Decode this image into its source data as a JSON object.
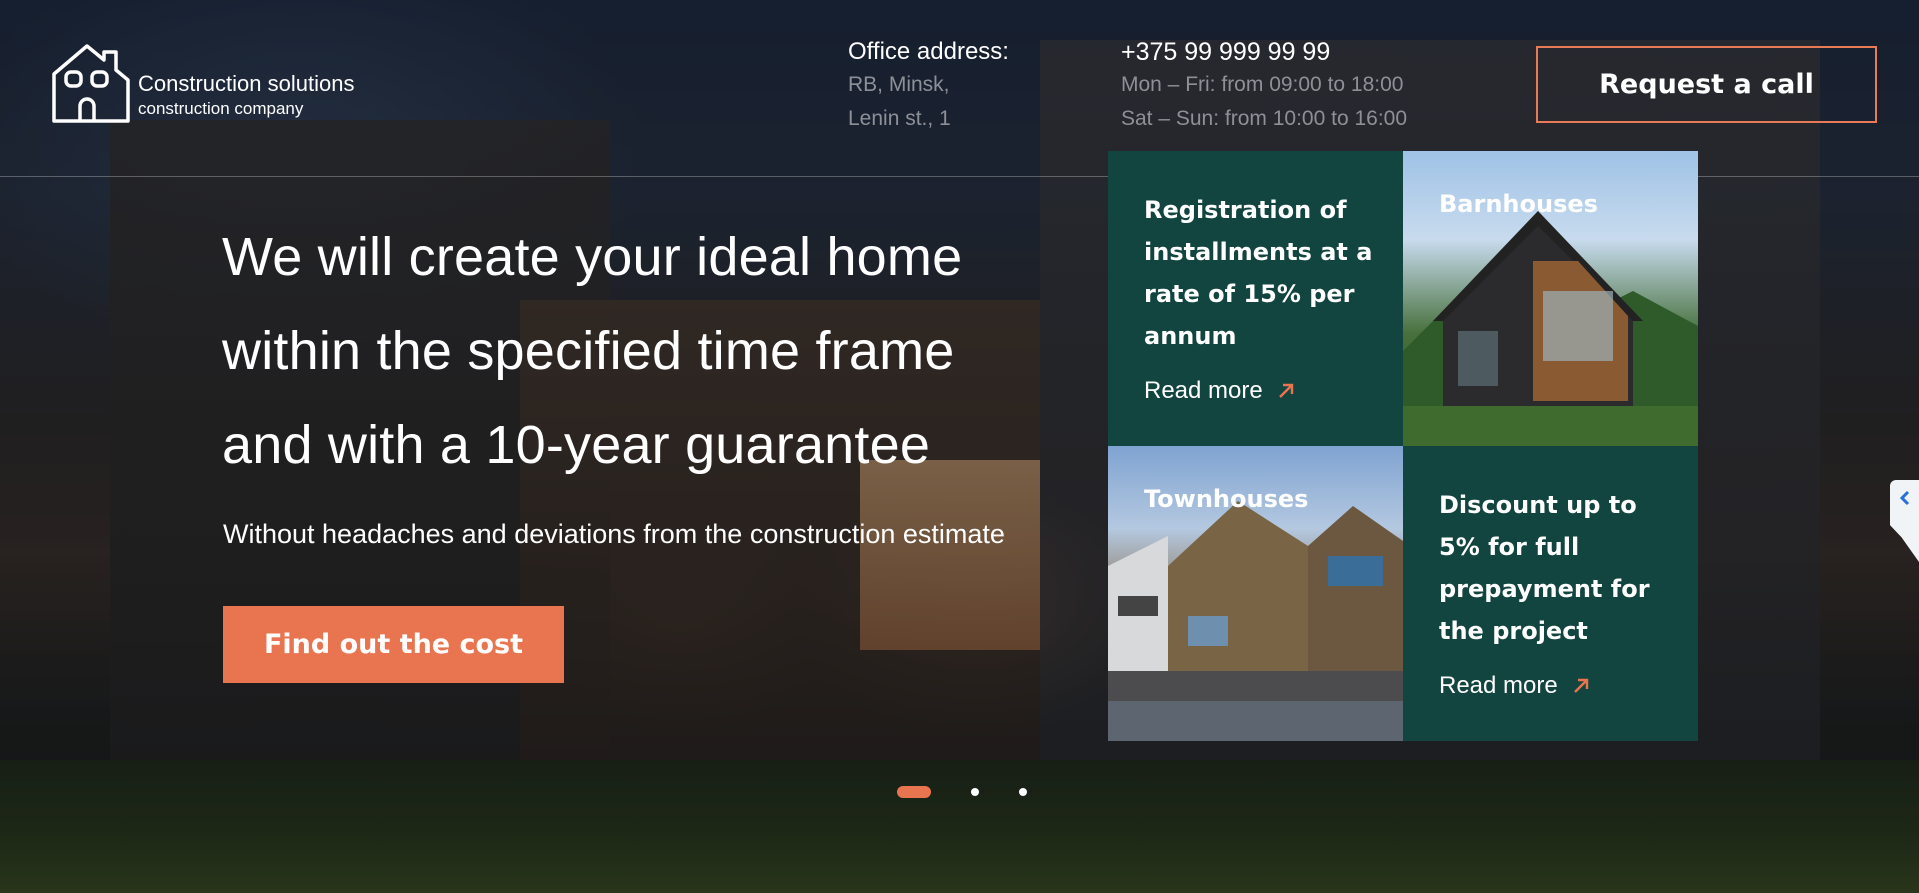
{
  "colors": {
    "accent": "#e8754f",
    "card_green": "#124440",
    "muted_text": "#8e9097"
  },
  "logo": {
    "name": "Construction solutions",
    "tagline": "construction company",
    "icon": "house-icon"
  },
  "office": {
    "label": "Office address:",
    "line1": "RB, Minsk,",
    "line2": "Lenin st., 1"
  },
  "contacts": {
    "phone": "+375 99 999 99 99",
    "weekdays": "Mon – Fri: from 09:00 to 18:00",
    "weekend": "Sat – Sun: from 10:00 to 16:00"
  },
  "header": {
    "call_button": "Request a call"
  },
  "hero": {
    "headline": [
      "We will create your ideal home",
      "within the specified time frame",
      "and with a 10-year guarantee"
    ],
    "subline": "Without headaches and deviations from the construction estimate",
    "cta": "Find out the cost"
  },
  "cards": [
    {
      "title": "Registration of installments at a rate of 15% per annum",
      "link": "Read more",
      "type": "promo"
    },
    {
      "title": "Barnhouses",
      "type": "photo"
    },
    {
      "title": "Townhouses",
      "type": "photo"
    },
    {
      "title": "Discount up to 5% for full prepayment for the project",
      "link": "Read more",
      "type": "promo"
    }
  ],
  "slider": {
    "slides": 3,
    "active": 1
  },
  "side_tab": {
    "icon": "chevron-left-icon"
  }
}
